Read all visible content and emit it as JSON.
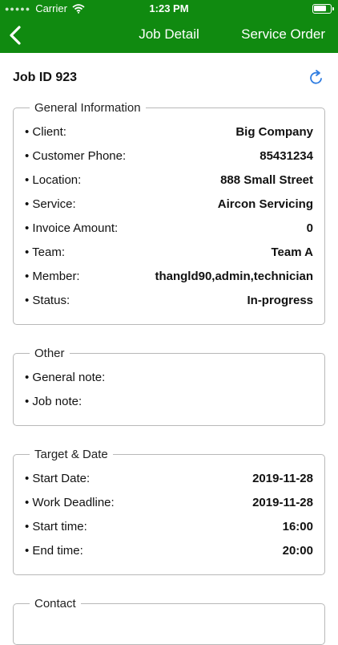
{
  "status_bar": {
    "carrier": "Carrier",
    "time": "1:23 PM"
  },
  "nav": {
    "title": "Job Detail",
    "right_button": "Service Order"
  },
  "job": {
    "id_label": "Job ID 923"
  },
  "general": {
    "title": "General Information",
    "rows": [
      {
        "label": "Client:",
        "value": "Big Company"
      },
      {
        "label": "Customer Phone:",
        "value": "85431234"
      },
      {
        "label": "Location:",
        "value": "888 Small Street"
      },
      {
        "label": "Service:",
        "value": "Aircon Servicing"
      },
      {
        "label": "Invoice Amount:",
        "value": "0"
      },
      {
        "label": "Team:",
        "value": "Team A"
      },
      {
        "label": "Member:",
        "value": "thangld90,admin,technician"
      },
      {
        "label": "Status:",
        "value": "In-progress"
      }
    ]
  },
  "other": {
    "title": "Other",
    "rows": [
      {
        "label": "General note:",
        "value": ""
      },
      {
        "label": "Job note:",
        "value": ""
      }
    ]
  },
  "target": {
    "title": "Target & Date",
    "rows": [
      {
        "label": "Start Date:",
        "value": "2019-11-28"
      },
      {
        "label": "Work Deadline:",
        "value": "2019-11-28"
      },
      {
        "label": "Start time:",
        "value": "16:00"
      },
      {
        "label": "End time:",
        "value": "20:00"
      }
    ]
  },
  "contact": {
    "title": "Contact"
  },
  "colors": {
    "brand_green": "#108a10",
    "refresh_blue": "#2f7de1"
  },
  "icons": [
    "wifi-icon",
    "battery-icon",
    "back-chevron-icon",
    "refresh-icon"
  ]
}
